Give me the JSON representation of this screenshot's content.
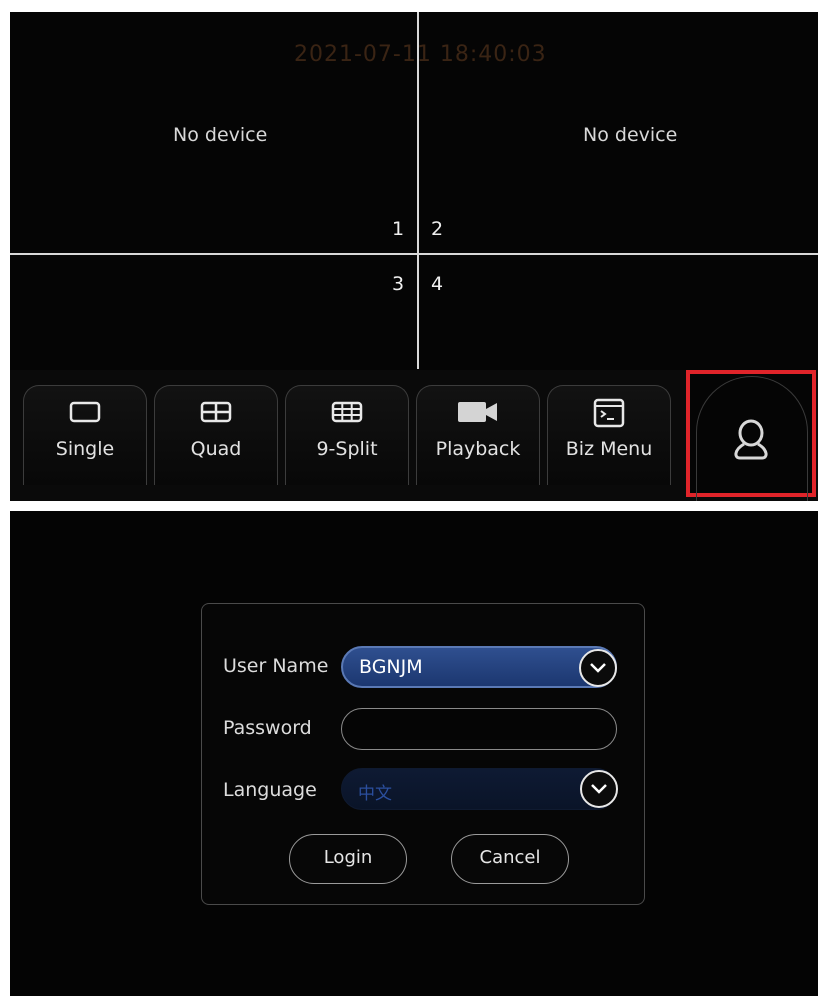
{
  "live_view": {
    "timestamp": "2021-07-11 18:40:03",
    "cells": [
      {
        "number": "1",
        "status": "No device"
      },
      {
        "number": "2",
        "status": "No device"
      },
      {
        "number": "3",
        "status": ""
      },
      {
        "number": "4",
        "status": ""
      }
    ],
    "toolbar": {
      "buttons": [
        {
          "label": "Single",
          "icon": "single-screen-icon"
        },
        {
          "label": "Quad",
          "icon": "quad-screen-icon"
        },
        {
          "label": "9-Split",
          "icon": "nine-split-icon"
        },
        {
          "label": "Playback",
          "icon": "video-camera-icon"
        },
        {
          "label": "Biz Menu",
          "icon": "terminal-menu-icon"
        }
      ],
      "user_button": {
        "icon": "user-icon",
        "highlight_color": "#e0242a"
      }
    }
  },
  "login": {
    "username_label": "User Name",
    "username_value": "BGNJM",
    "password_label": "Password",
    "password_value": "",
    "language_label": "Language",
    "language_value": "中文",
    "login_button": "Login",
    "cancel_button": "Cancel"
  },
  "colors": {
    "background": "#050505",
    "grid_line": "#d9d9d9",
    "select_blue": "#2f4f8f",
    "highlight_red": "#e0242a"
  }
}
